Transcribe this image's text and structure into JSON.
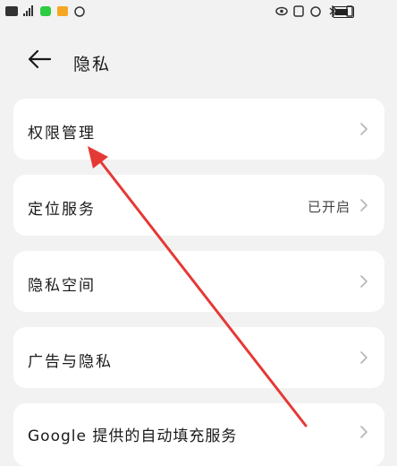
{
  "page": {
    "title": "隐私"
  },
  "items": [
    {
      "label": "权限管理",
      "value": ""
    },
    {
      "label": "定位服务",
      "value": "已开启"
    },
    {
      "label": "隐私空间",
      "value": ""
    },
    {
      "label": "广告与隐私",
      "value": ""
    },
    {
      "label": "Google 提供的自动填充服务",
      "value": ""
    }
  ],
  "colors": {
    "background": "#f2f2f2",
    "card": "#ffffff",
    "annotation_arrow": "#e53935"
  }
}
